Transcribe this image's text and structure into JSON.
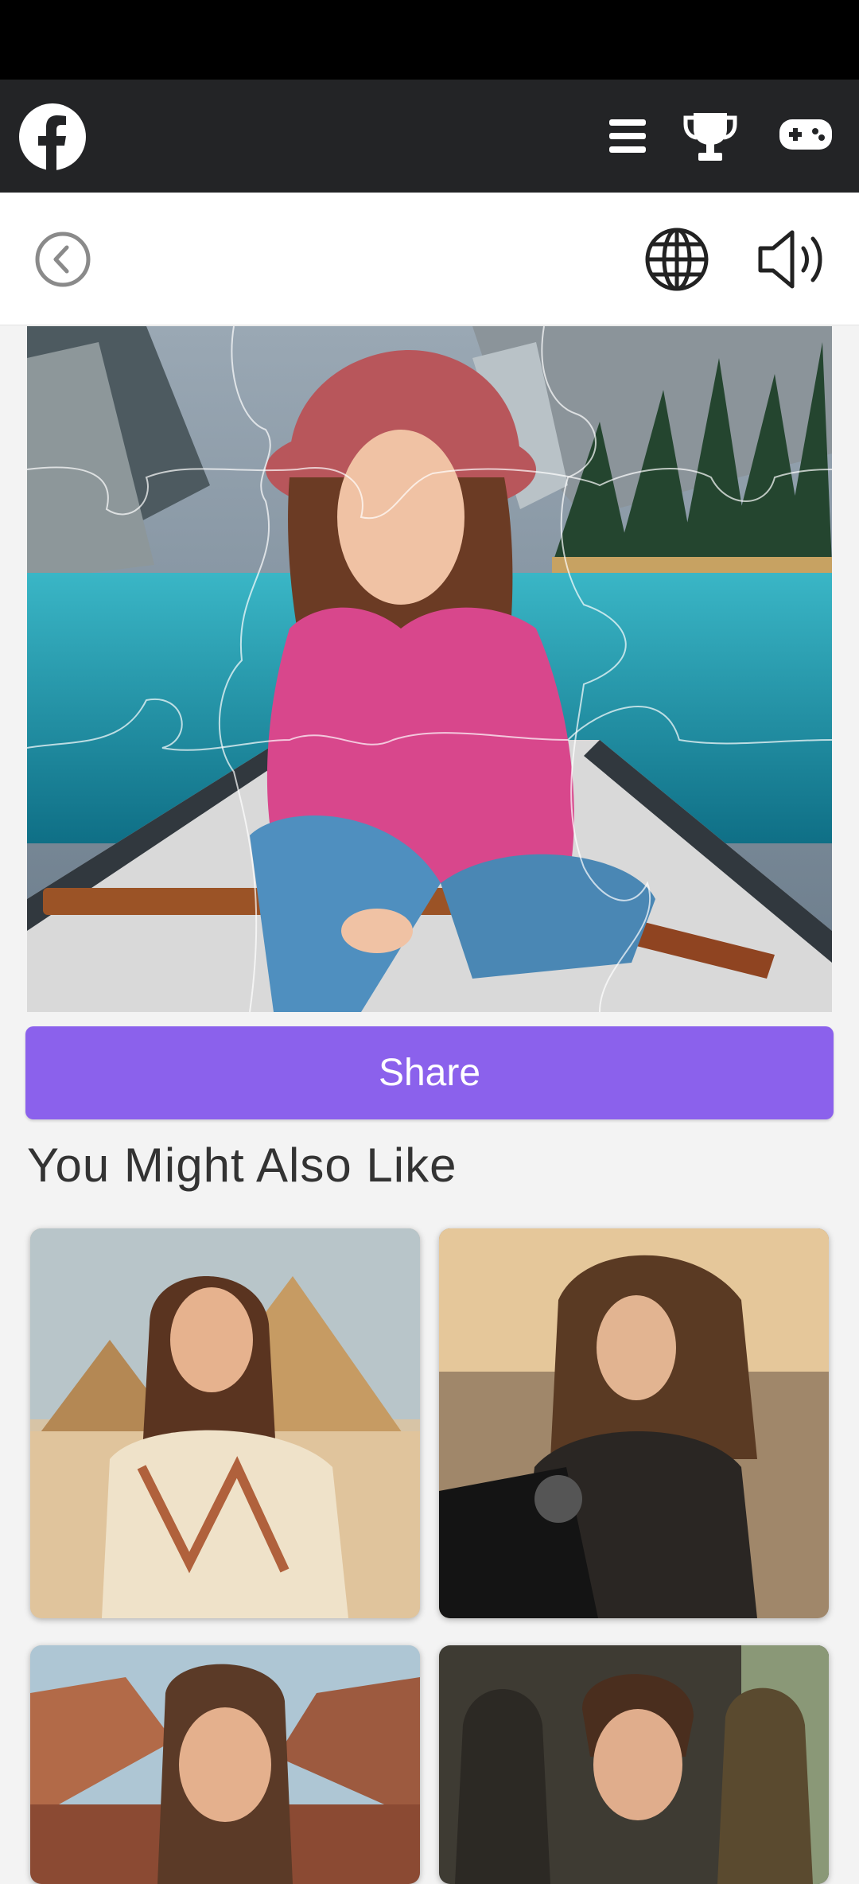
{
  "top_bar": {
    "logo": "facebook-logo",
    "icons": [
      "menu-icon",
      "trophy-icon",
      "gamepad-icon"
    ]
  },
  "sub_bar": {
    "icons": [
      "back-icon",
      "globe-icon",
      "speaker-icon"
    ]
  },
  "puzzle": {
    "image": "woman-in-pink-sweater-and-hat-sitting-in-boat-on-mountain-lake"
  },
  "share_button": {
    "label": "Share"
  },
  "recommendations": {
    "title": "You Might Also Like",
    "items": [
      {
        "image": "woman-with-scarf-at-pyramids"
      },
      {
        "image": "woman-in-leather-jacket-on-motorcycle"
      },
      {
        "image": "woman-at-canyon"
      },
      {
        "image": "young-man-with-statues"
      }
    ]
  },
  "colors": {
    "top_bar_bg": "#232426",
    "accent": "#8b61ec",
    "page_bg": "#f3f3f3"
  }
}
